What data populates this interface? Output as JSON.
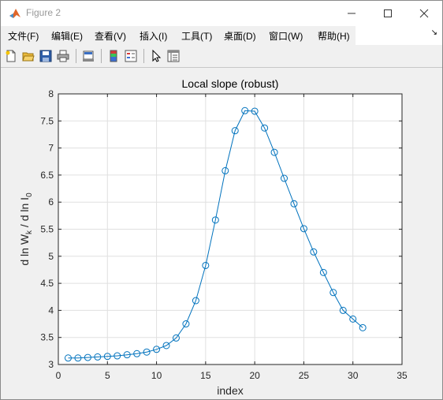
{
  "window": {
    "title": "Figure 2",
    "minimize_icon": "minimize-icon",
    "maximize_icon": "maximize-icon",
    "close_icon": "close-icon"
  },
  "menu": {
    "items": [
      "文件(F)",
      "编辑(E)",
      "查看(V)",
      "插入(I)",
      "工具(T)",
      "桌面(D)",
      "窗口(W)",
      "帮助(H)"
    ],
    "overflow_icon": "dock-arrow-icon"
  },
  "toolbar": {
    "icons": [
      "new-figure-icon",
      "open-icon",
      "save-icon",
      "print-icon",
      "link-plot-icon",
      "colorbar-icon",
      "legend-icon",
      "pointer-icon",
      "property-inspector-icon"
    ]
  },
  "colors": {
    "line": "#0072BD",
    "axes_bg": "#ffffff",
    "grid": "#e0e0e0",
    "figure_bg": "#f0f0f0"
  },
  "chart_data": {
    "type": "line",
    "title": "Local slope (robust)",
    "xlabel": "index",
    "ylabel_parts": [
      "d ln W",
      "k",
      " / d ln I",
      "0"
    ],
    "xlim": [
      0,
      35
    ],
    "ylim": [
      3,
      8
    ],
    "xticks": [
      0,
      5,
      10,
      15,
      20,
      25,
      30,
      35
    ],
    "yticks": [
      3,
      3.5,
      4,
      4.5,
      5,
      5.5,
      6,
      6.5,
      7,
      7.5,
      8
    ],
    "xtick_labels": [
      "0",
      "5",
      "10",
      "15",
      "20",
      "25",
      "30",
      "35"
    ],
    "ytick_labels": [
      "3",
      "3.5",
      "4",
      "4.5",
      "5",
      "5.5",
      "6",
      "6.5",
      "7",
      "7.5",
      "8"
    ],
    "grid": true,
    "marker": "circle",
    "x": [
      1,
      2,
      3,
      4,
      5,
      6,
      7,
      8,
      9,
      10,
      11,
      12,
      13,
      14,
      15,
      16,
      17,
      18,
      19,
      20,
      21,
      22,
      23,
      24,
      25,
      26,
      27,
      28,
      29,
      30,
      31
    ],
    "y": [
      3.12,
      3.12,
      3.13,
      3.14,
      3.15,
      3.16,
      3.18,
      3.2,
      3.23,
      3.28,
      3.35,
      3.49,
      3.75,
      4.18,
      4.83,
      5.67,
      6.58,
      7.32,
      7.69,
      7.68,
      7.37,
      6.92,
      6.44,
      5.97,
      5.51,
      5.08,
      4.7,
      4.33,
      4.0,
      3.84,
      3.68
    ]
  }
}
